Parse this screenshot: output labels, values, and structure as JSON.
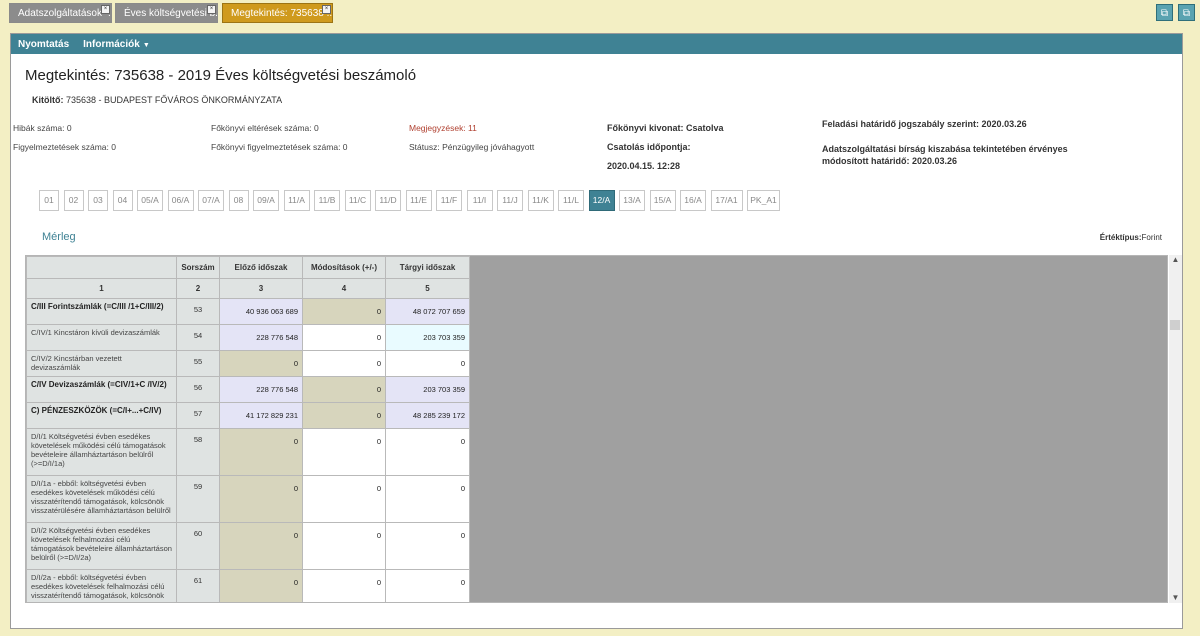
{
  "tabs": [
    {
      "label": "Adatszolgáltatások -..."
    },
    {
      "label": "Éves költségvetési b..."
    },
    {
      "label": "Megtekintés: 735638 ..."
    }
  ],
  "menu": {
    "print": "Nyomtatás",
    "info": "Információk"
  },
  "header": {
    "title": "Megtekintés: 735638 - 2019 Éves költségvetési beszámoló",
    "filler_label": "Kitöltő:",
    "filler_value": "735638 - BUDAPEST FŐVÁROS ÖNKORMÁNYZATA"
  },
  "stats": {
    "errors": "Hibák száma: 0",
    "warnings": "Figyelmeztetések száma: 0",
    "ledger_diff": "Főkönyvi eltérések száma: 0",
    "ledger_warn": "Főkönyvi figyelmeztetések száma: 0",
    "notes": "Megjegyzések: 11",
    "status": "Státusz: Pénzügyileg jóváhagyott",
    "ledger_extract": "Főkönyvi kivonat: Csatolva",
    "attach_time_label": "Csatolás időpontja:",
    "attach_time": "2020.04.15. 12:28",
    "deadline": "Feladási határidő jogszabály szerint: 2020.03.26",
    "fine_line1": "Adatszolgáltatási bírság kiszabása tekintetében érvényes",
    "fine_line2": "módosított határidő: 2020.03.26"
  },
  "sheets": [
    "01",
    "02",
    "03",
    "04",
    "05/A",
    "06/A",
    "07/A",
    "08",
    "09/A",
    "11/A",
    "11/B",
    "11/C",
    "11/D",
    "11/E",
    "11/F",
    "11/I",
    "11/J",
    "11/K",
    "11/L",
    "12/A",
    "13/A",
    "15/A",
    "16/A",
    "17/A1",
    "PK_A1"
  ],
  "active_sheet": "12/A",
  "section": {
    "title": "Mérleg",
    "unit_label": "Értéktípus:",
    "unit_value": "Forint"
  },
  "table": {
    "headers": [
      "",
      "Sorszám",
      "Előző időszak",
      "Módosítások (+/-)",
      "Tárgyi időszak"
    ],
    "col_numbers": [
      "1",
      "2",
      "3",
      "4",
      "5"
    ],
    "rows": [
      {
        "label": "C/III Forintszámlák (=C/III /1+C/III/2)",
        "bold": true,
        "no": "53",
        "prev": "40 936 063 689",
        "mod": "0",
        "curr": "48 072 707 659"
      },
      {
        "label": "C/IV/1 Kincstáron kívüli devizaszámlák",
        "bold": false,
        "no": "54",
        "prev": "228 776 548",
        "mod": "0",
        "curr": "203 703 359"
      },
      {
        "label": "C/IV/2 Kincstárban vezetett devizaszámlák",
        "bold": false,
        "no": "55",
        "prev": "0",
        "mod": "0",
        "curr": "0"
      },
      {
        "label": "C/IV Devizaszámlák (=CIV/1+C /IV/2)",
        "bold": true,
        "no": "56",
        "prev": "228 776 548",
        "mod": "0",
        "curr": "203 703 359"
      },
      {
        "label": "C) PÉNZESZKÖZÖK (=C/I+...+C/IV)",
        "bold": true,
        "no": "57",
        "prev": "41 172 829 231",
        "mod": "0",
        "curr": "48 285 239 172"
      },
      {
        "label": "D/I/1 Költségvetési évben esedékes követelések működési célú támogatások bevételeire államháztartáson belülről (>=D/I/1a)",
        "bold": false,
        "no": "58",
        "prev": "0",
        "mod": "0",
        "curr": "0"
      },
      {
        "label": "D/I/1a - ebből: költségvetési évben esedékes követelések működési célú visszatérítendő támogatások, kölcsönök visszatérülésére államháztartáson belülről",
        "bold": false,
        "no": "59",
        "prev": "0",
        "mod": "0",
        "curr": "0"
      },
      {
        "label": "D/I/2 Költségvetési évben esedékes követelések felhalmozási célú támogatások bevételeire államháztartáson belülről (>=D/I/2a)",
        "bold": false,
        "no": "60",
        "prev": "0",
        "mod": "0",
        "curr": "0"
      },
      {
        "label": "D/I/2a - ebből: költségvetési évben esedékes követelések felhalmozási célú visszatérítendő támogatások, kölcsönök",
        "bold": false,
        "no": "61",
        "prev": "0",
        "mod": "0",
        "curr": "0"
      }
    ]
  }
}
